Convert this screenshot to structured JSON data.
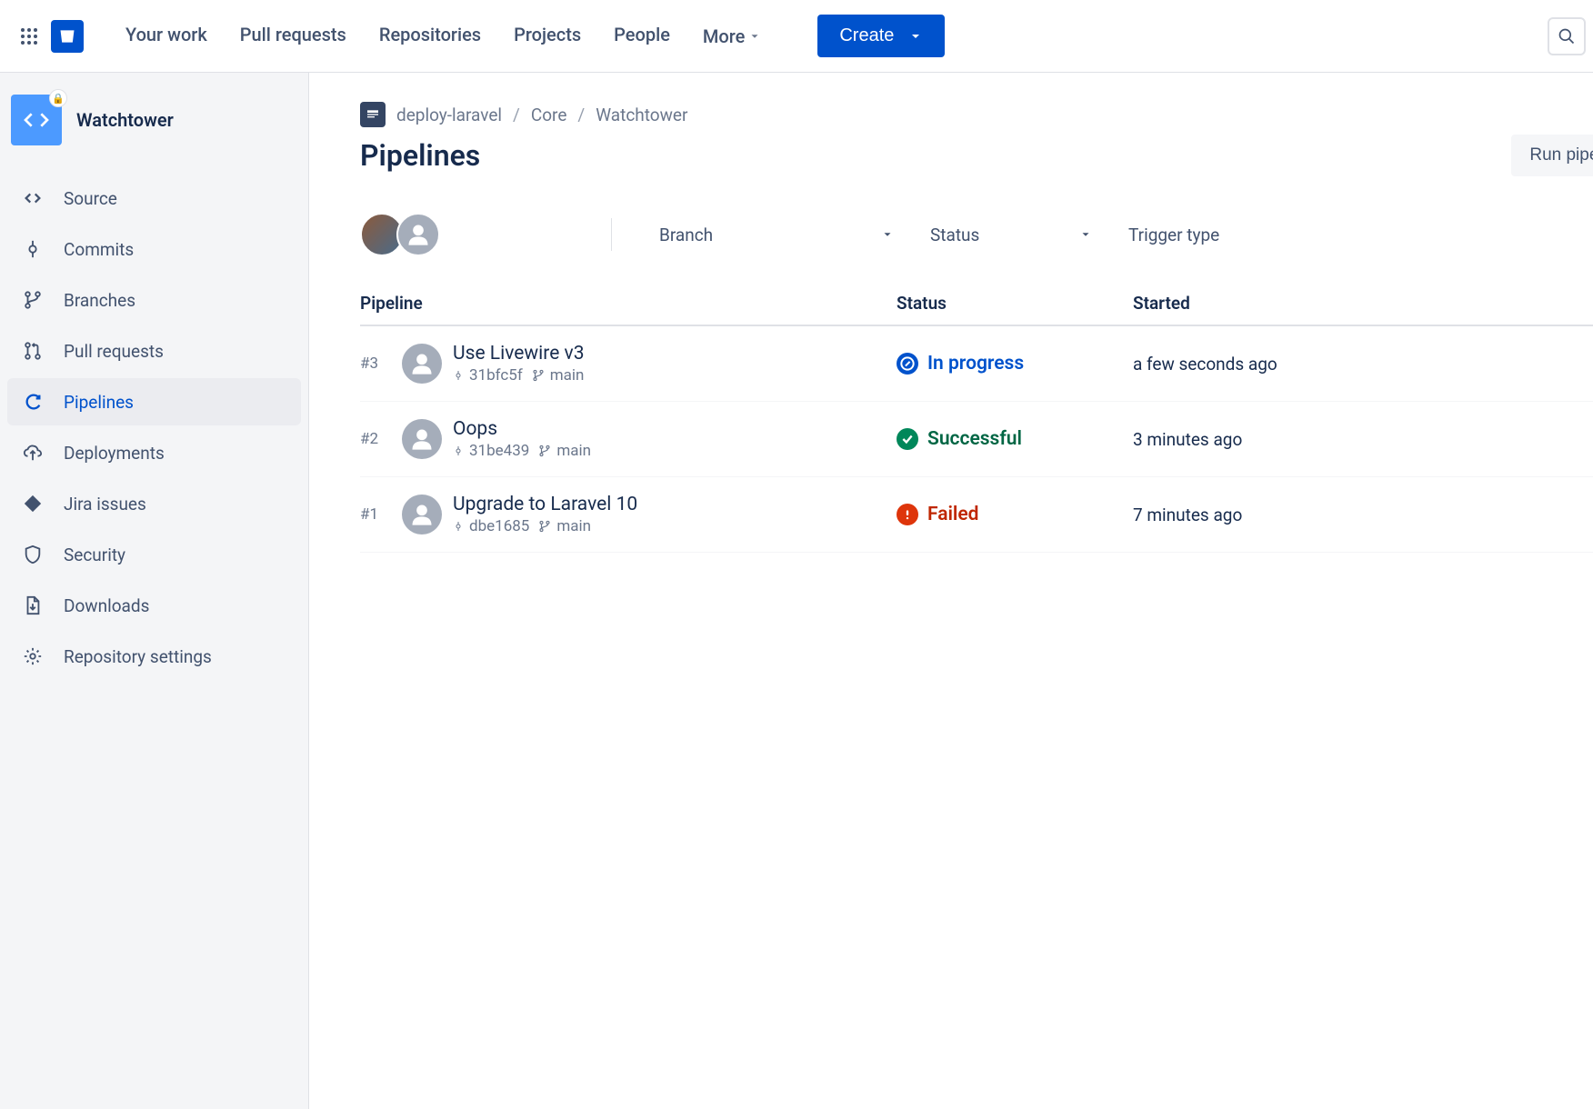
{
  "topbar": {
    "nav": [
      "Your work",
      "Pull requests",
      "Repositories",
      "Projects",
      "People",
      "More"
    ],
    "create": "Create"
  },
  "sidebar": {
    "repo_name": "Watchtower",
    "items": [
      {
        "icon": "code",
        "label": "Source"
      },
      {
        "icon": "commit",
        "label": "Commits"
      },
      {
        "icon": "branch",
        "label": "Branches"
      },
      {
        "icon": "pr",
        "label": "Pull requests"
      },
      {
        "icon": "pipeline",
        "label": "Pipelines"
      },
      {
        "icon": "deploy",
        "label": "Deployments"
      },
      {
        "icon": "jira",
        "label": "Jira issues"
      },
      {
        "icon": "shield",
        "label": "Security"
      },
      {
        "icon": "download",
        "label": "Downloads"
      },
      {
        "icon": "gear",
        "label": "Repository settings"
      }
    ],
    "active_index": 4
  },
  "breadcrumb": [
    "deploy-laravel",
    "Core",
    "Watchtower"
  ],
  "page_title": "Pipelines",
  "run_button": "Run pipeline",
  "filters": {
    "branch": "Branch",
    "status": "Status",
    "trigger": "Trigger type"
  },
  "table": {
    "headers": {
      "pipeline": "Pipeline",
      "status": "Status",
      "started": "Started"
    },
    "rows": [
      {
        "num": "#3",
        "title": "Use Livewire v3",
        "hash": "31bfc5f",
        "branch": "main",
        "status": "in_progress",
        "status_label": "In progress",
        "started": "a few seconds ago"
      },
      {
        "num": "#2",
        "title": "Oops",
        "hash": "31be439",
        "branch": "main",
        "status": "success",
        "status_label": "Successful",
        "started": "3 minutes ago"
      },
      {
        "num": "#1",
        "title": "Upgrade to Laravel 10",
        "hash": "dbe1685",
        "branch": "main",
        "status": "failed",
        "status_label": "Failed",
        "started": "7 minutes ago"
      }
    ]
  },
  "colors": {
    "primary": "#0052CC",
    "success": "#00875A",
    "failed": "#DE350B"
  }
}
